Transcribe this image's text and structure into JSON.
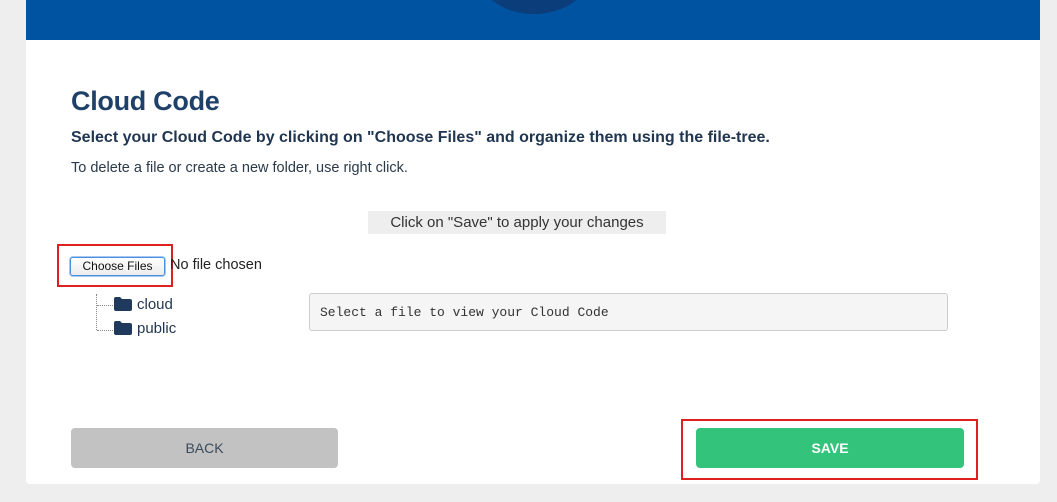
{
  "page": {
    "title": "Cloud Code",
    "subtitle": "Select your Cloud Code by clicking on \"Choose Files\" and organize them using the file-tree.",
    "hint": "To delete a file or create a new folder, use right click.",
    "save_notice": "Click on \"Save\" to apply your changes"
  },
  "file_picker": {
    "button_label": "Choose Files",
    "status": "No file chosen"
  },
  "file_tree": {
    "items": [
      {
        "label": "cloud",
        "icon": "folder-icon"
      },
      {
        "label": "public",
        "icon": "folder-icon"
      }
    ]
  },
  "code_viewer": {
    "placeholder": "Select a file to view your Cloud Code"
  },
  "actions": {
    "back_label": "BACK",
    "save_label": "SAVE"
  },
  "colors": {
    "header": "#0053a0",
    "title": "#1f4068",
    "save": "#33c37a",
    "back": "#c2c2c2",
    "highlight": "#e02020"
  }
}
